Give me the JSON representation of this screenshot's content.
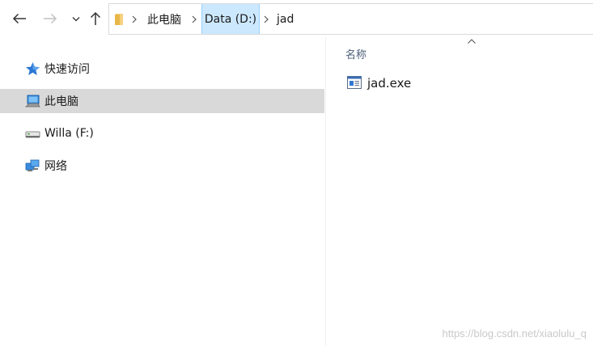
{
  "address_bar": {
    "crumbs": [
      "此电脑",
      "Data (D:)",
      "jad"
    ],
    "active_crumb": "Data (D:)"
  },
  "icons": {
    "back": "arrow-left-icon",
    "forward": "arrow-right-icon",
    "recent": "chevron-down-icon",
    "up": "arrow-up-icon",
    "address_folder": "folder-icon",
    "quick_access": "star-icon",
    "this_pc": "computer-icon",
    "drive": "usb-drive-icon",
    "network": "network-icon",
    "file": "executable-file-icon",
    "sort": "sort-ascending-icon"
  },
  "sidebar": {
    "items": [
      {
        "label": "快速访问",
        "selected": false
      },
      {
        "label": "此电脑",
        "selected": true
      },
      {
        "label": "Willa (F:)",
        "selected": false
      },
      {
        "label": "网络",
        "selected": false
      }
    ]
  },
  "main": {
    "column_header": "名称",
    "files": [
      {
        "name": "jad.exe"
      }
    ]
  },
  "watermark": "https://blog.csdn.net/xiaolulu_q",
  "colors": {
    "selection": "#d9d9d9",
    "crumb_highlight": "#cce8ff",
    "star": "#2b78d4",
    "header_text": "#4c607a"
  }
}
